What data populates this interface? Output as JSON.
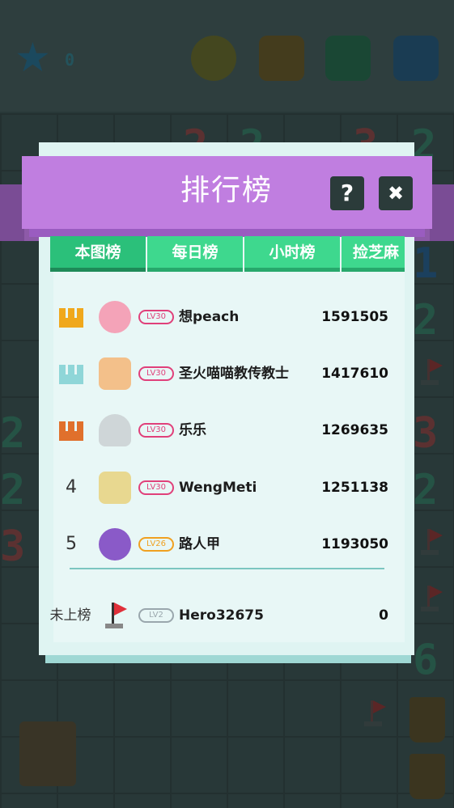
{
  "background": {
    "star_count": "0",
    "board_numbers": [
      {
        "text": "2",
        "color": "#7a3a3a"
      },
      {
        "text": "2",
        "color": "#2d6b57"
      },
      {
        "text": "3",
        "color": "#7a3a3a"
      },
      {
        "text": "2",
        "color": "#2d6b57"
      },
      {
        "text": "1",
        "color": "#1f4f7a"
      },
      {
        "text": "2",
        "color": "#2d6b57"
      },
      {
        "text": "3",
        "color": "#7a3a3a"
      },
      {
        "text": "2",
        "color": "#2d6b57"
      },
      {
        "text": "2",
        "color": "#2d6b57"
      },
      {
        "text": "2",
        "color": "#2d6b57"
      },
      {
        "text": "3",
        "color": "#7a3a3a"
      },
      {
        "text": "6",
        "color": "#2d6b57"
      }
    ]
  },
  "leaderboard": {
    "title": "排行榜",
    "help_label": "?",
    "close_label": "✖",
    "tabs": [
      {
        "label": "本图榜",
        "active": true
      },
      {
        "label": "每日榜",
        "active": false
      },
      {
        "label": "小时榜",
        "active": false
      },
      {
        "label": "捡芝麻",
        "active": false
      }
    ],
    "rows": [
      {
        "rank": "1",
        "crown_color": "#f0a81c",
        "avatar_color": "#f4a3b8",
        "level": "LV30",
        "level_style": "pink",
        "name": "想peach",
        "score": "1591505"
      },
      {
        "rank": "2",
        "crown_color": "#8fd6d8",
        "avatar_color": "#f3c08a",
        "level": "LV30",
        "level_style": "pink",
        "name": "圣火喵喵教传教士",
        "score": "1417610"
      },
      {
        "rank": "3",
        "crown_color": "#e0702c",
        "avatar_color": "#cfd6d8",
        "level": "LV30",
        "level_style": "pink",
        "name": "乐乐",
        "score": "1269635"
      },
      {
        "rank": "4",
        "crown_color": "",
        "avatar_color": "#e8d890",
        "level": "LV30",
        "level_style": "pink",
        "name": "WengMeti",
        "score": "1251138"
      },
      {
        "rank": "5",
        "crown_color": "",
        "avatar_color": "#8a5ac8",
        "level": "LV26",
        "level_style": "orange",
        "name": "路人甲",
        "score": "1193050"
      }
    ],
    "me": {
      "rank_text": "未上榜",
      "level": "LV2",
      "name": "Hero32675",
      "score": "0"
    }
  }
}
